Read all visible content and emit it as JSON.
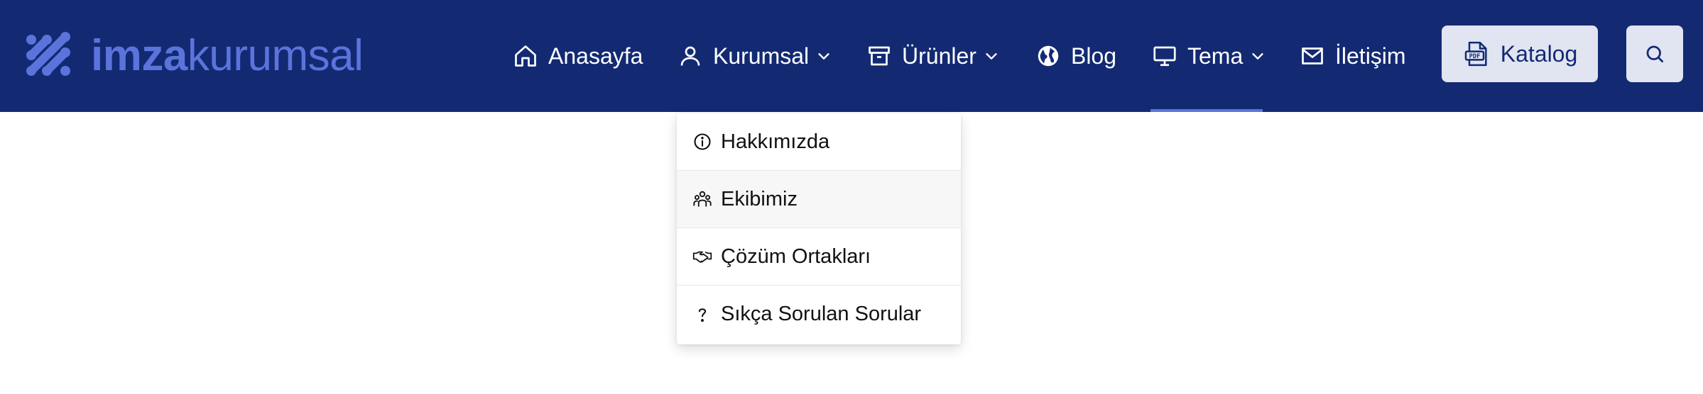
{
  "brand": {
    "name_bold": "imza",
    "name_light": "kurumsal",
    "color": "#5b74dc"
  },
  "colors": {
    "navbar_bg": "#132a73",
    "button_bg": "#e1e5f2",
    "accent": "#5b74dc"
  },
  "nav": {
    "items": [
      {
        "label": "Anasayfa",
        "icon": "home-icon"
      },
      {
        "label": "Kurumsal",
        "icon": "user-icon",
        "dropdown": true
      },
      {
        "label": "Ürünler",
        "icon": "archive-icon",
        "dropdown": true
      },
      {
        "label": "Blog",
        "icon": "globe-icon"
      },
      {
        "label": "Tema",
        "icon": "monitor-icon",
        "dropdown": true,
        "active": true
      },
      {
        "label": "İletişim",
        "icon": "mail-icon"
      }
    ],
    "katalog_label": "Katalog",
    "katalog_icon": "pdf-icon",
    "search_icon": "search-icon"
  },
  "dropdown": {
    "items": [
      {
        "label": "Hakkımızda",
        "icon": "info-icon"
      },
      {
        "label": "Ekibimiz",
        "icon": "team-icon",
        "hovered": true
      },
      {
        "label": "Çözüm Ortakları",
        "icon": "handshake-icon"
      },
      {
        "label": "Sıkça Sorulan Sorular",
        "icon": "question-icon"
      }
    ]
  }
}
